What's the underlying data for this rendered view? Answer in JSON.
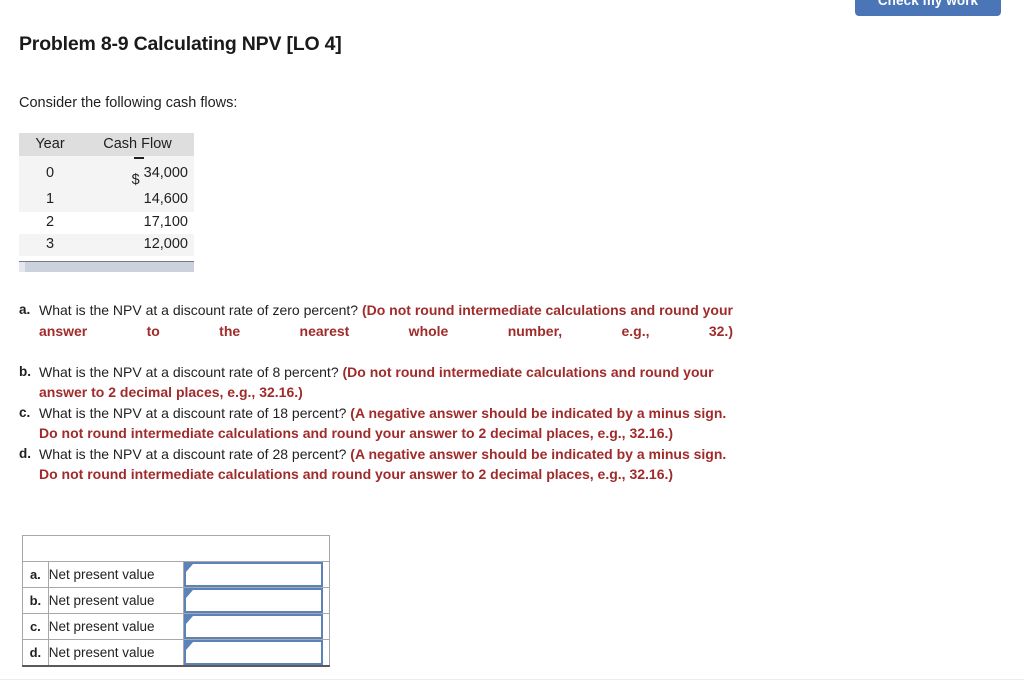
{
  "toolbar": {
    "check_my_work_label": "Check my work"
  },
  "header": {
    "title": "Problem 8-9 Calculating NPV [LO 4]"
  },
  "intro": {
    "text": "Consider the following cash flows:"
  },
  "cash_flow_table": {
    "columns": [
      "Year",
      "Cash Flow"
    ],
    "rows": [
      {
        "year": "0",
        "currency": "$",
        "sign": "−",
        "amount": "34,000"
      },
      {
        "year": "1",
        "currency": "",
        "sign": "",
        "amount": "14,600"
      },
      {
        "year": "2",
        "currency": "",
        "sign": "",
        "amount": "17,100"
      },
      {
        "year": "3",
        "currency": "",
        "sign": "",
        "amount": "12,000"
      }
    ]
  },
  "questions": [
    {
      "label": "a.",
      "question": "What is the NPV at a discount rate of zero percent?",
      "hint": "(Do not round intermediate calculations and round your answer to the nearest whole number, e.g., 32.)"
    },
    {
      "label": "b.",
      "question": "What is the NPV at a discount rate of 8 percent?",
      "hint": "(Do not round intermediate calculations and round your answer to 2 decimal places, e.g., 32.16.)"
    },
    {
      "label": "c.",
      "question": "What is the NPV at a discount rate of 18 percent?",
      "hint": "(A negative answer should be indicated by a minus sign. Do not round intermediate calculations and round your answer to 2 decimal places, e.g., 32.16.)"
    },
    {
      "label": "d.",
      "question": "What is the NPV at a discount rate of 28 percent?",
      "hint": "(A negative answer should be indicated by a minus sign. Do not round intermediate calculations and round your answer to 2 decimal places, e.g., 32.16.)"
    }
  ],
  "answer_table": {
    "header_label": "",
    "rows": [
      {
        "letter": "a.",
        "label": "Net present value",
        "value": "",
        "placeholder": ""
      },
      {
        "letter": "b.",
        "label": "Net present value",
        "value": "",
        "placeholder": ""
      },
      {
        "letter": "c.",
        "label": "Net present value",
        "value": "",
        "placeholder": ""
      },
      {
        "letter": "d.",
        "label": "Net present value",
        "value": "",
        "placeholder": ""
      }
    ]
  },
  "colors": {
    "button_blue": "#4a76b8",
    "hint_red": "#a02b2b",
    "table_header_gray": "#dedede",
    "answer_header_blue_gray": "#d6dae6",
    "input_border_blue": "#5c82ba"
  }
}
